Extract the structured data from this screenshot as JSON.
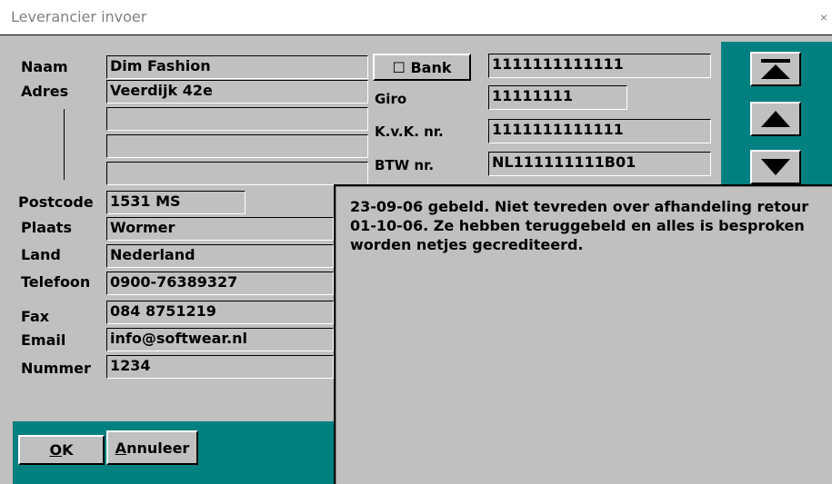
{
  "window": {
    "title": "Leverancier invoer",
    "close": "×"
  },
  "labels": {
    "naam": "Naam",
    "adres": "Adres",
    "postcode": "Postcode",
    "plaats": "Plaats",
    "land": "Land",
    "telefoon": "Telefoon",
    "fax": "Fax",
    "email": "Email",
    "nummer": "Nummer",
    "giro": "Giro",
    "kvk": "K.v.K. nr.",
    "btw": "BTW nr."
  },
  "fields": {
    "naam": "Dim Fashion",
    "adres1": "Veerdijk 42e",
    "adres2": "",
    "adres3": "",
    "adres4": "",
    "postcode": "1531 MS",
    "plaats": "Wormer",
    "land": "Nederland",
    "telefoon": "0900-76389327",
    "fax": "084 8751219",
    "email": "info@softwear.nl",
    "nummer": "1234",
    "bank": "1111111111111",
    "giro": "11111111",
    "kvk": "1111111111111",
    "btw": "NL111111111B01"
  },
  "buttons": {
    "bank": "☐ Bank",
    "ok_mnemonic": "O",
    "ok_rest": "K",
    "annuleer_mnemonic": "A",
    "annuleer_rest": "nnuleer"
  },
  "notes": {
    "lines": [
      "23-09-06 gebeld. Niet tevreden over afhandeling retour",
      "01-10-06. Ze hebben teruggebeld en alles is besproken",
      "worden netjes gecrediteerd."
    ]
  },
  "colors": {
    "panel": "#c0c0c0",
    "accent": "#008080"
  },
  "icons": {
    "first": "first-record-icon",
    "prev": "previous-record-icon",
    "next": "next-record-icon"
  }
}
